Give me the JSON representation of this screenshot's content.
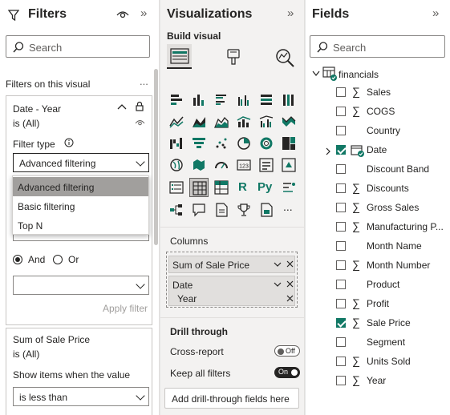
{
  "filters": {
    "title": "Filters",
    "search_placeholder": "Search",
    "section_label": "Filters on this visual",
    "more": "...",
    "card1": {
      "title": "Date - Year",
      "subtitle": "is (All)",
      "filter_type_label": "Filter type",
      "filter_type_value": "Advanced filtering",
      "menu": [
        "Advanced filtering",
        "Basic filtering",
        "Top N"
      ],
      "and_label": "And",
      "or_label": "Or",
      "apply_label": "Apply filter"
    },
    "card2": {
      "title": "Sum of Sale Price",
      "subtitle": "is (All)",
      "show_label": "Show items when the value",
      "condition": "is less than"
    }
  },
  "viz": {
    "title": "Visualizations",
    "build_label": "Build visual",
    "columns_label": "Columns",
    "wells": {
      "sum_sale_price": "Sum of Sale Price",
      "date": "Date",
      "year": "Year"
    },
    "drill_title": "Drill through",
    "cross_report": "Cross-report",
    "cross_report_state": "Off",
    "keep_filters": "Keep all filters",
    "keep_filters_state": "On",
    "add_drill": "Add drill-through fields here",
    "gallery_text_icons": {
      "r": "R",
      "py": "Py",
      "more": "...",
      "num": "123"
    }
  },
  "fields": {
    "title": "Fields",
    "search_placeholder": "Search",
    "table": "financials",
    "items": [
      {
        "name": "Sales",
        "sigma": true,
        "checked": false
      },
      {
        "name": "COGS",
        "sigma": true,
        "checked": false
      },
      {
        "name": "Country",
        "sigma": false,
        "checked": false
      },
      {
        "name": "Date",
        "sigma": false,
        "checked": true,
        "hierarchy": true
      },
      {
        "name": "Discount Band",
        "sigma": false,
        "checked": false
      },
      {
        "name": "Discounts",
        "sigma": true,
        "checked": false
      },
      {
        "name": "Gross Sales",
        "sigma": true,
        "checked": false
      },
      {
        "name": "Manufacturing P...",
        "sigma": true,
        "checked": false
      },
      {
        "name": "Month Name",
        "sigma": false,
        "checked": false
      },
      {
        "name": "Month Number",
        "sigma": true,
        "checked": false
      },
      {
        "name": "Product",
        "sigma": false,
        "checked": false
      },
      {
        "name": "Profit",
        "sigma": true,
        "checked": false
      },
      {
        "name": "Sale Price",
        "sigma": true,
        "checked": true
      },
      {
        "name": "Segment",
        "sigma": false,
        "checked": false
      },
      {
        "name": "Units Sold",
        "sigma": true,
        "checked": false
      },
      {
        "name": "Year",
        "sigma": true,
        "checked": false
      }
    ]
  },
  "colors": {
    "accent_green": "#117865",
    "selected_menu": "#a19f9d"
  }
}
